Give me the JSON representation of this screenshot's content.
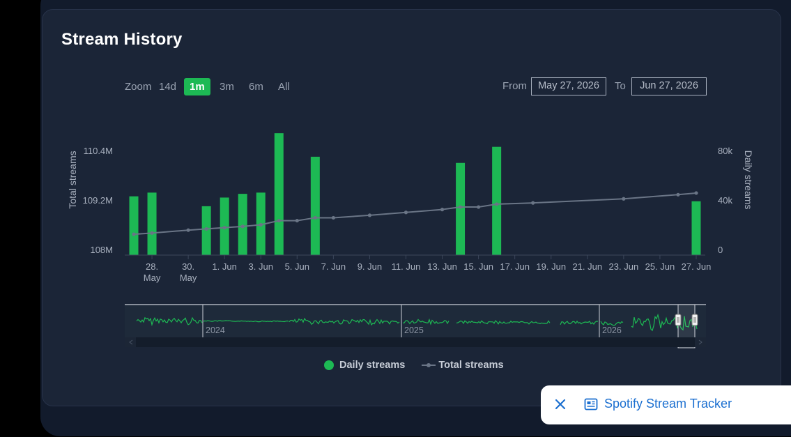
{
  "title": "Stream History",
  "zoom": {
    "label": "Zoom",
    "options": [
      "14d",
      "1m",
      "3m",
      "6m",
      "All"
    ],
    "selected": "1m"
  },
  "range": {
    "from_label": "From",
    "from_value": "May 27, 2026",
    "to_label": "To",
    "to_value": "Jun 27, 2026"
  },
  "colors": {
    "bar": "#1db954",
    "line": "#6a7586",
    "axis_text": "#a9b1bf",
    "nav_line": "#1db954"
  },
  "chart_data": {
    "type": "bar",
    "x_dates": [
      "2026-05-27",
      "2026-05-28",
      "2026-05-29",
      "2026-05-30",
      "2026-05-31",
      "2026-06-01",
      "2026-06-02",
      "2026-06-03",
      "2026-06-04",
      "2026-06-05",
      "2026-06-06",
      "2026-06-07",
      "2026-06-08",
      "2026-06-09",
      "2026-06-10",
      "2026-06-11",
      "2026-06-12",
      "2026-06-13",
      "2026-06-14",
      "2026-06-15",
      "2026-06-16",
      "2026-06-17",
      "2026-06-18",
      "2026-06-19",
      "2026-06-20",
      "2026-06-21",
      "2026-06-22",
      "2026-06-23",
      "2026-06-24",
      "2026-06-25",
      "2026-06-26",
      "2026-06-27"
    ],
    "x_tick_labels": [
      "28. May",
      "30. May",
      "1. Jun",
      "3. Jun",
      "5. Jun",
      "7. Jun",
      "9. Jun",
      "11. Jun",
      "13. Jun",
      "15. Jun",
      "17. Jun",
      "19. Jun",
      "21. Jun",
      "23. Jun",
      "25. Jun",
      "27. Jun"
    ],
    "x_tick_dates": [
      "2026-05-28",
      "2026-05-30",
      "2026-06-01",
      "2026-06-03",
      "2026-06-05",
      "2026-06-07",
      "2026-06-09",
      "2026-06-11",
      "2026-06-13",
      "2026-06-15",
      "2026-06-17",
      "2026-06-19",
      "2026-06-21",
      "2026-06-23",
      "2026-06-25",
      "2026-06-27"
    ],
    "series": [
      {
        "name": "Daily streams",
        "type": "bar",
        "axis": "right",
        "points": [
          {
            "date": "2026-05-27",
            "value": 43000
          },
          {
            "date": "2026-05-28",
            "value": 46000
          },
          {
            "date": "2026-05-31",
            "value": 35000
          },
          {
            "date": "2026-06-01",
            "value": 42000
          },
          {
            "date": "2026-06-02",
            "value": 45000
          },
          {
            "date": "2026-06-03",
            "value": 46000
          },
          {
            "date": "2026-06-04",
            "value": 94000
          },
          {
            "date": "2026-06-06",
            "value": 75000
          },
          {
            "date": "2026-06-14",
            "value": 70000
          },
          {
            "date": "2026-06-16",
            "value": 83000
          },
          {
            "date": "2026-06-27",
            "value": 39000
          }
        ]
      },
      {
        "name": "Total streams",
        "type": "line",
        "axis": "left",
        "points": [
          {
            "date": "2026-05-27",
            "value": 108.37
          },
          {
            "date": "2026-05-28",
            "value": 108.4
          },
          {
            "date": "2026-05-30",
            "value": 108.47
          },
          {
            "date": "2026-05-31",
            "value": 108.5
          },
          {
            "date": "2026-06-01",
            "value": 108.53
          },
          {
            "date": "2026-06-02",
            "value": 108.56
          },
          {
            "date": "2026-06-03",
            "value": 108.6
          },
          {
            "date": "2026-06-04",
            "value": 108.7
          },
          {
            "date": "2026-06-05",
            "value": 108.7
          },
          {
            "date": "2026-06-06",
            "value": 108.77
          },
          {
            "date": "2026-06-07",
            "value": 108.77
          },
          {
            "date": "2026-06-09",
            "value": 108.83
          },
          {
            "date": "2026-06-11",
            "value": 108.9
          },
          {
            "date": "2026-06-13",
            "value": 108.97
          },
          {
            "date": "2026-06-14",
            "value": 109.03
          },
          {
            "date": "2026-06-15",
            "value": 109.03
          },
          {
            "date": "2026-06-16",
            "value": 109.1
          },
          {
            "date": "2026-06-18",
            "value": 109.13
          },
          {
            "date": "2026-06-23",
            "value": 109.23
          },
          {
            "date": "2026-06-26",
            "value": 109.33
          },
          {
            "date": "2026-06-27",
            "value": 109.37
          }
        ]
      }
    ],
    "left_axis": {
      "label": "Total streams",
      "ticks": [
        108.0,
        109.2,
        110.4
      ],
      "tick_labels": [
        "108M",
        "109.2M",
        "110.4M"
      ],
      "range": [
        108.0,
        110.4
      ]
    },
    "right_axis": {
      "label": "Daily streams",
      "ticks": [
        0,
        40000,
        80000
      ],
      "tick_labels": [
        "0",
        "40k",
        "80k"
      ],
      "range": [
        0,
        80000
      ]
    },
    "legend": [
      "Daily streams",
      "Total streams"
    ],
    "legend_position": "bottom-center",
    "navigator": {
      "year_labels": [
        "2024",
        "2025",
        "2026"
      ],
      "selection": "last month"
    }
  },
  "toast": {
    "label": "Spotify Stream Tracker",
    "close_icon": "close-icon",
    "icon": "newspaper-icon"
  }
}
